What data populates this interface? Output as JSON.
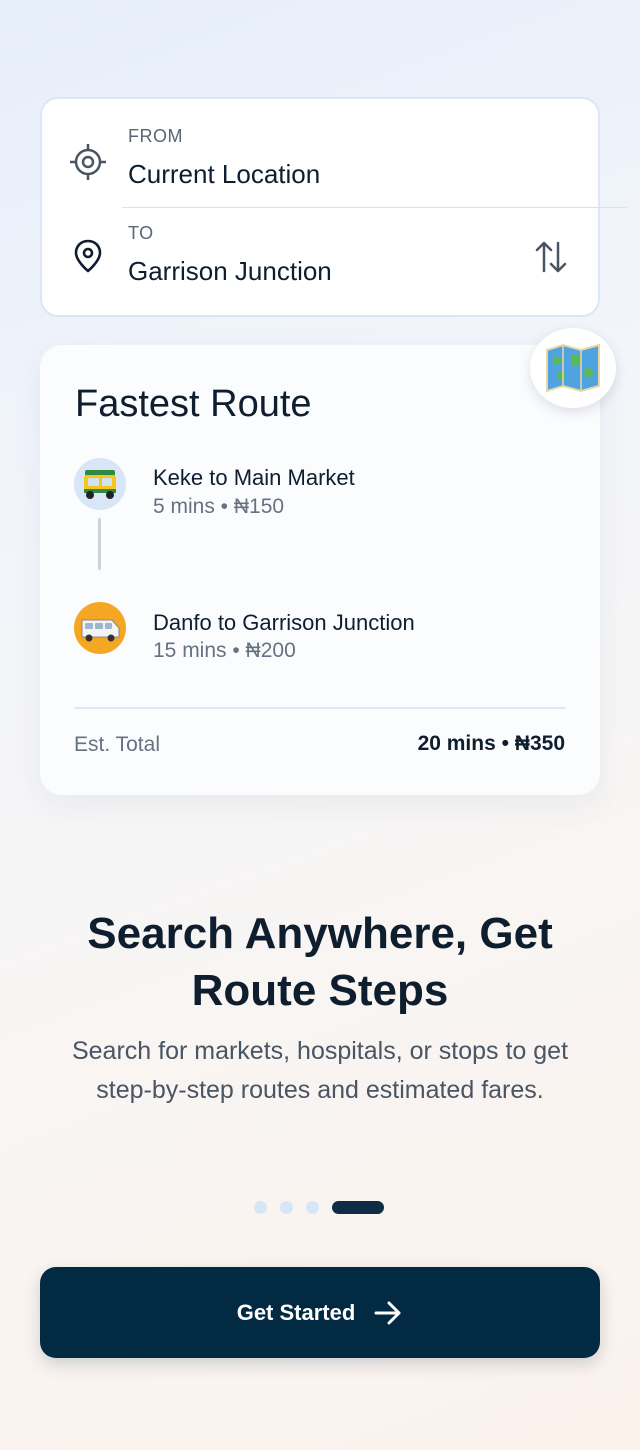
{
  "search": {
    "from_label": "FROM",
    "from_value": "Current Location",
    "to_label": "TO",
    "to_value": "Garrison Junction"
  },
  "route": {
    "title": "Fastest Route",
    "steps": [
      {
        "title": "Keke to Main Market",
        "detail": "5 mins • ₦150",
        "icon": "keke-icon"
      },
      {
        "title": "Danfo to Garrison Junction",
        "detail": "15 mins • ₦200",
        "icon": "danfo-bus-icon"
      }
    ],
    "total_label": "Est. Total",
    "total_value": "20 mins • ₦350"
  },
  "hero": {
    "headline_line1": "Search Anywhere, Get",
    "headline_line2": "Route Steps",
    "description": "Search for markets, hospitals, or stops to get step-by-step routes and estimated fares."
  },
  "pager": {
    "total": 4,
    "active_index": 3
  },
  "cta": {
    "label": "Get Started"
  },
  "colors": {
    "primary": "#022a42",
    "accent_light": "#d7e6f7",
    "danfo_yellow": "#f5a623"
  }
}
